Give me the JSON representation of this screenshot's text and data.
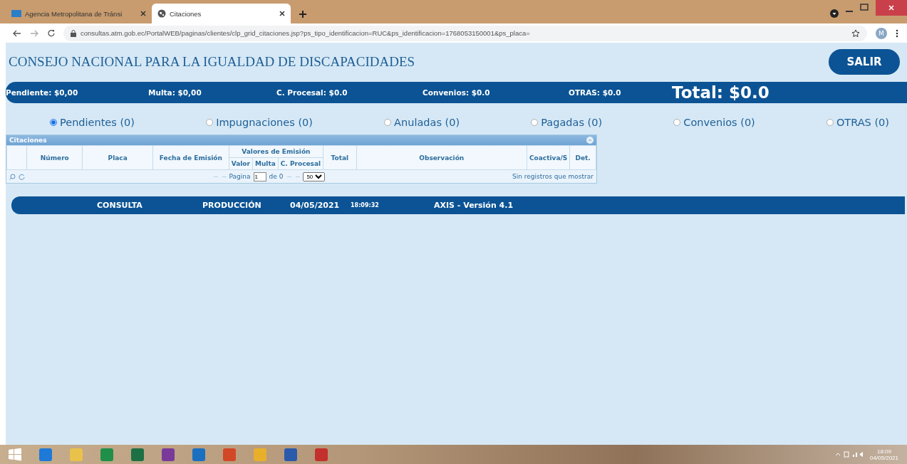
{
  "browser": {
    "tabs": [
      {
        "title": "Agencia Metropolitana de Tránsi",
        "selected": false
      },
      {
        "title": "Citaciones",
        "selected": true
      }
    ],
    "address": "consultas.atm.gob.ec/PortalWEB/paginas/clientes/clp_grid_citaciones.jsp?ps_tipo_identificacion=RUC&ps_identificacion=1768053150001&ps_placa=",
    "profile": "M"
  },
  "header": {
    "title": "CONSEJO NACIONAL PARA LA IGUALDAD DE DISCAPACIDADES",
    "exit_button": "SALIR"
  },
  "summary": {
    "items": [
      "Pendiente: $0,00",
      "Multa: $0,00",
      "C. Procesal: $0.0",
      "Convenios: $0.0",
      "OTRAS: $0.0"
    ],
    "total": "Total: $0.0"
  },
  "filters": [
    {
      "label": "Pendientes (0)",
      "selected": true
    },
    {
      "label": "Impugnaciones (0)",
      "selected": false
    },
    {
      "label": "Anuladas (0)",
      "selected": false
    },
    {
      "label": "Pagadas (0)",
      "selected": false
    },
    {
      "label": "Convenios (0)",
      "selected": false
    },
    {
      "label": "OTRAS (0)",
      "selected": false
    }
  ],
  "grid": {
    "title": "Citaciones",
    "columns": [
      "Número",
      "Placa",
      "Fecha de Emisión"
    ],
    "group": {
      "label": "Valores de Emisión",
      "columns": [
        "Valor",
        "Multa",
        "C. Procesal"
      ]
    },
    "columns_after": [
      "Total",
      "Observación",
      "Coactiva/S",
      "Det."
    ],
    "pager": {
      "label": "Pagina",
      "page": "1",
      "of": "de 0",
      "page_size": "50"
    },
    "status": "Sin registros que mostrar"
  },
  "footer": {
    "items": [
      "CONSULTA",
      "PRODUCCIÓN"
    ],
    "date": "04/05/2021",
    "time": "18:09:32",
    "version": "AXIS - Versión 4.1"
  },
  "taskbar": {
    "clock": "18:09",
    "date": "04/05/2021"
  }
}
